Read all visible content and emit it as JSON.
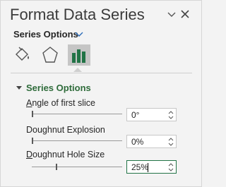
{
  "pane": {
    "title": "Format Data Series",
    "collapse_icon": "chevron-down-icon",
    "close_icon": "close-icon",
    "series_dropdown": {
      "label": "Series Options",
      "icon": "chevron-down-icon"
    },
    "tabs": [
      {
        "name": "fill-line-icon"
      },
      {
        "name": "effects-icon"
      },
      {
        "name": "series-options-icon",
        "selected": true
      }
    ]
  },
  "section": {
    "title": "Series Options",
    "expanded": true
  },
  "rows": [
    {
      "label_underline": "A",
      "label_rest": "ngle of first slice",
      "value": "0°",
      "slider_fraction": 0.0
    },
    {
      "label_underline": "",
      "label_rest": "Doughnut Explosion",
      "value": "0%",
      "slider_fraction": 0.0
    },
    {
      "label_underline": "D",
      "label_rest": "oughnut Hole Size",
      "value": "25%",
      "slider_fraction": 0.25,
      "focused": true
    }
  ],
  "colors": {
    "accent_green": "#217346",
    "section_text": "#2e6b3a",
    "bar_icon": "#217346"
  }
}
